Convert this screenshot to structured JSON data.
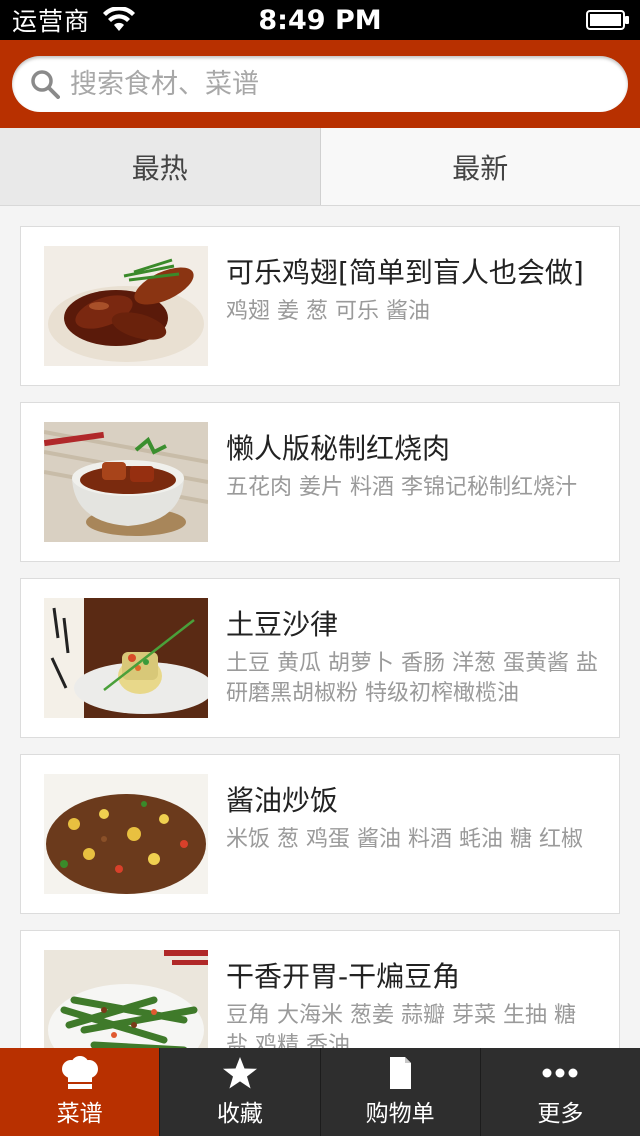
{
  "status_bar": {
    "carrier": "运营商",
    "time": "8:49 PM",
    "icons": [
      "wifi-icon",
      "battery-icon"
    ]
  },
  "search": {
    "placeholder": "搜索食材、菜谱",
    "icon": "search-icon"
  },
  "tabs": [
    {
      "label": "最热",
      "active": true
    },
    {
      "label": "最新",
      "active": false
    }
  ],
  "recipes": [
    {
      "title": "可乐鸡翅[简单到盲人也会做]",
      "ingredients": "鸡翅 姜 葱 可乐 酱油"
    },
    {
      "title": "懒人版秘制红烧肉",
      "ingredients": "五花肉 姜片 料酒 李锦记秘制红烧汁"
    },
    {
      "title": "土豆沙律",
      "ingredients": "土豆 黄瓜 胡萝卜 香肠 洋葱 蛋黄酱 盐 研磨黑胡椒粉 特级初榨橄榄油"
    },
    {
      "title": "酱油炒饭",
      "ingredients": "米饭 葱 鸡蛋 酱油 料酒 蚝油 糖 红椒"
    },
    {
      "title": "干香开胃-干煸豆角",
      "ingredients": "豆角 大海米 葱姜 蒜瓣 芽菜 生抽 糖 盐 鸡精 香油"
    }
  ],
  "tabbar": [
    {
      "label": "菜谱",
      "icon": "chef-hat-icon",
      "active": true
    },
    {
      "label": "收藏",
      "icon": "star-icon",
      "active": false
    },
    {
      "label": "购物单",
      "icon": "document-icon",
      "active": false
    },
    {
      "label": "更多",
      "icon": "more-dots-icon",
      "active": false
    }
  ],
  "colors": {
    "accent": "#b83000",
    "tabbar_bg": "#2e2e2e",
    "page_bg": "#f4f4f4"
  }
}
